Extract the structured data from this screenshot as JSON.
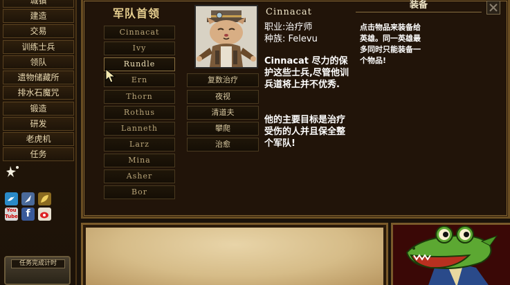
{
  "left_menu": {
    "items": [
      "城镇",
      "建造",
      "交易",
      "训练士兵",
      "领队",
      "遗物储藏所",
      "排水石魔咒",
      "锻造",
      "研发",
      "老虎机",
      "任务"
    ],
    "social_icons": [
      "twitter-icon",
      "feather-icon",
      "leaf-icon",
      "youtube-icon",
      "facebook-icon",
      "weibo-icon"
    ],
    "youtube_label": "You Tube",
    "facebook_label": "f",
    "timer_label": "任务完成计时"
  },
  "roster": {
    "title": "军队首领",
    "heroes": [
      "Cinnacat",
      "Ivy",
      "Rundle",
      "Ern",
      "Thorn",
      "Rothus",
      "Lanneth",
      "Larz",
      "Mina",
      "Asher",
      "Bor"
    ],
    "selected_index": 2
  },
  "skills": [
    "复数治疗",
    "夜视",
    "清道夫",
    "攀爬",
    "治愈"
  ],
  "hero": {
    "name": "Cinnacat",
    "class_line": "职业:治疗师",
    "race_line": "种族: Felevu",
    "description_1": "Cinnacat 尽力的保护这些士兵,尽管他训兵道将上并不优秀.",
    "description_2": "他的主要目标是治疗受伤的人并且保全整个军队!"
  },
  "equipment": {
    "header": "装备",
    "hint": "点击物品来装备给英雄。同一英雄最多同时只能装备一个物品!"
  },
  "colors": {
    "panel_border": "#6a4e22",
    "gold_text": "#e8d090",
    "parchment": "#e8d4a8",
    "croc_green": "#4c9a28"
  }
}
